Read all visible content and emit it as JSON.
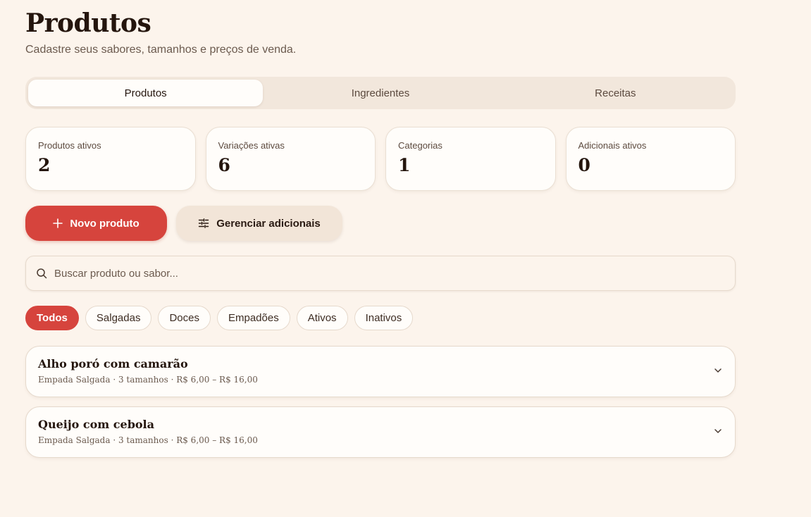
{
  "header": {
    "title": "Produtos",
    "subtitle": "Cadastre seus sabores, tamanhos e preços de venda."
  },
  "tabs": [
    {
      "label": "Produtos",
      "active": true
    },
    {
      "label": "Ingredientes",
      "active": false
    },
    {
      "label": "Receitas",
      "active": false
    }
  ],
  "stats": [
    {
      "label": "Produtos ativos",
      "value": "2"
    },
    {
      "label": "Variações ativas",
      "value": "6"
    },
    {
      "label": "Categorias",
      "value": "1"
    },
    {
      "label": "Adicionais ativos",
      "value": "0"
    }
  ],
  "actions": {
    "new_product": "Novo produto",
    "manage_addons": "Gerenciar adicionais"
  },
  "search": {
    "placeholder": "Buscar produto ou sabor...",
    "value": ""
  },
  "filters": [
    {
      "label": "Todos",
      "active": true
    },
    {
      "label": "Salgadas",
      "active": false
    },
    {
      "label": "Doces",
      "active": false
    },
    {
      "label": "Empadões",
      "active": false
    },
    {
      "label": "Ativos",
      "active": false
    },
    {
      "label": "Inativos",
      "active": false
    }
  ],
  "products": [
    {
      "name": "Alho poró com camarão",
      "meta": "Empada Salgada · 3 tamanhos · R$ 6,00 – R$ 16,00"
    },
    {
      "name": "Queijo com cebola",
      "meta": "Empada Salgada · 3 tamanhos · R$ 6,00 – R$ 16,00"
    }
  ],
  "colors": {
    "background": "#fcf4ec",
    "accent": "#d6443d",
    "card": "#fffdfa",
    "tab_track": "#f2e7dc"
  },
  "icons": {
    "new_product": "plus-icon",
    "manage_addons": "sliders-icon",
    "search": "search-icon",
    "expand": "chevron-down-icon"
  }
}
